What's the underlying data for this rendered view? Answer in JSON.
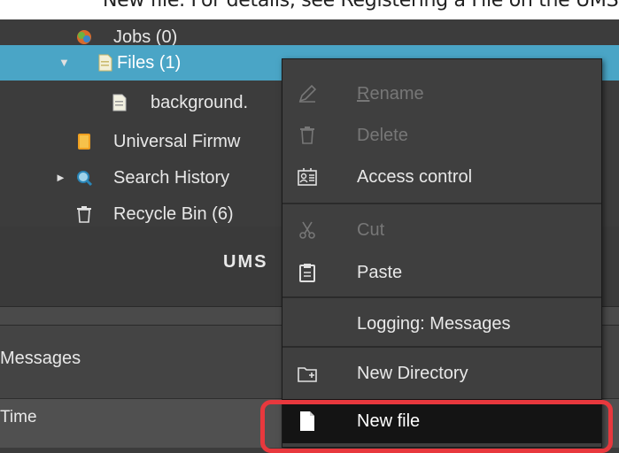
{
  "doc_text": "New file. For details, see Registering a File on the UMS",
  "tree": {
    "items": [
      {
        "label": "Jobs (0)",
        "icon": "jobs-icon"
      },
      {
        "label": "Files (1)",
        "icon": "file-icon",
        "expanded": true,
        "selected": true
      },
      {
        "label": "background.",
        "icon": "file-icon"
      },
      {
        "label": "Universal Firmw",
        "icon": "firmware-icon"
      },
      {
        "label": "Search History",
        "icon": "search-icon"
      },
      {
        "label": "Recycle Bin (6)",
        "icon": "recycle-bin-icon"
      }
    ]
  },
  "ums_title": "UMS",
  "messages_label": "Messages",
  "time_header": "Time",
  "context_menu": {
    "rename": "Rename",
    "rename_mnemonic": "R",
    "rename_rest": "ename",
    "delete": "Delete",
    "access_control": "Access control",
    "cut": "Cut",
    "paste": "Paste",
    "logging": "Logging: Messages",
    "new_directory": "New Directory",
    "new_file": "New file"
  },
  "colors": {
    "selection": "#4aa5c6",
    "highlight_border": "#e8383d",
    "menu_bg": "#3f3f3f",
    "menu_hover": "#141414"
  }
}
